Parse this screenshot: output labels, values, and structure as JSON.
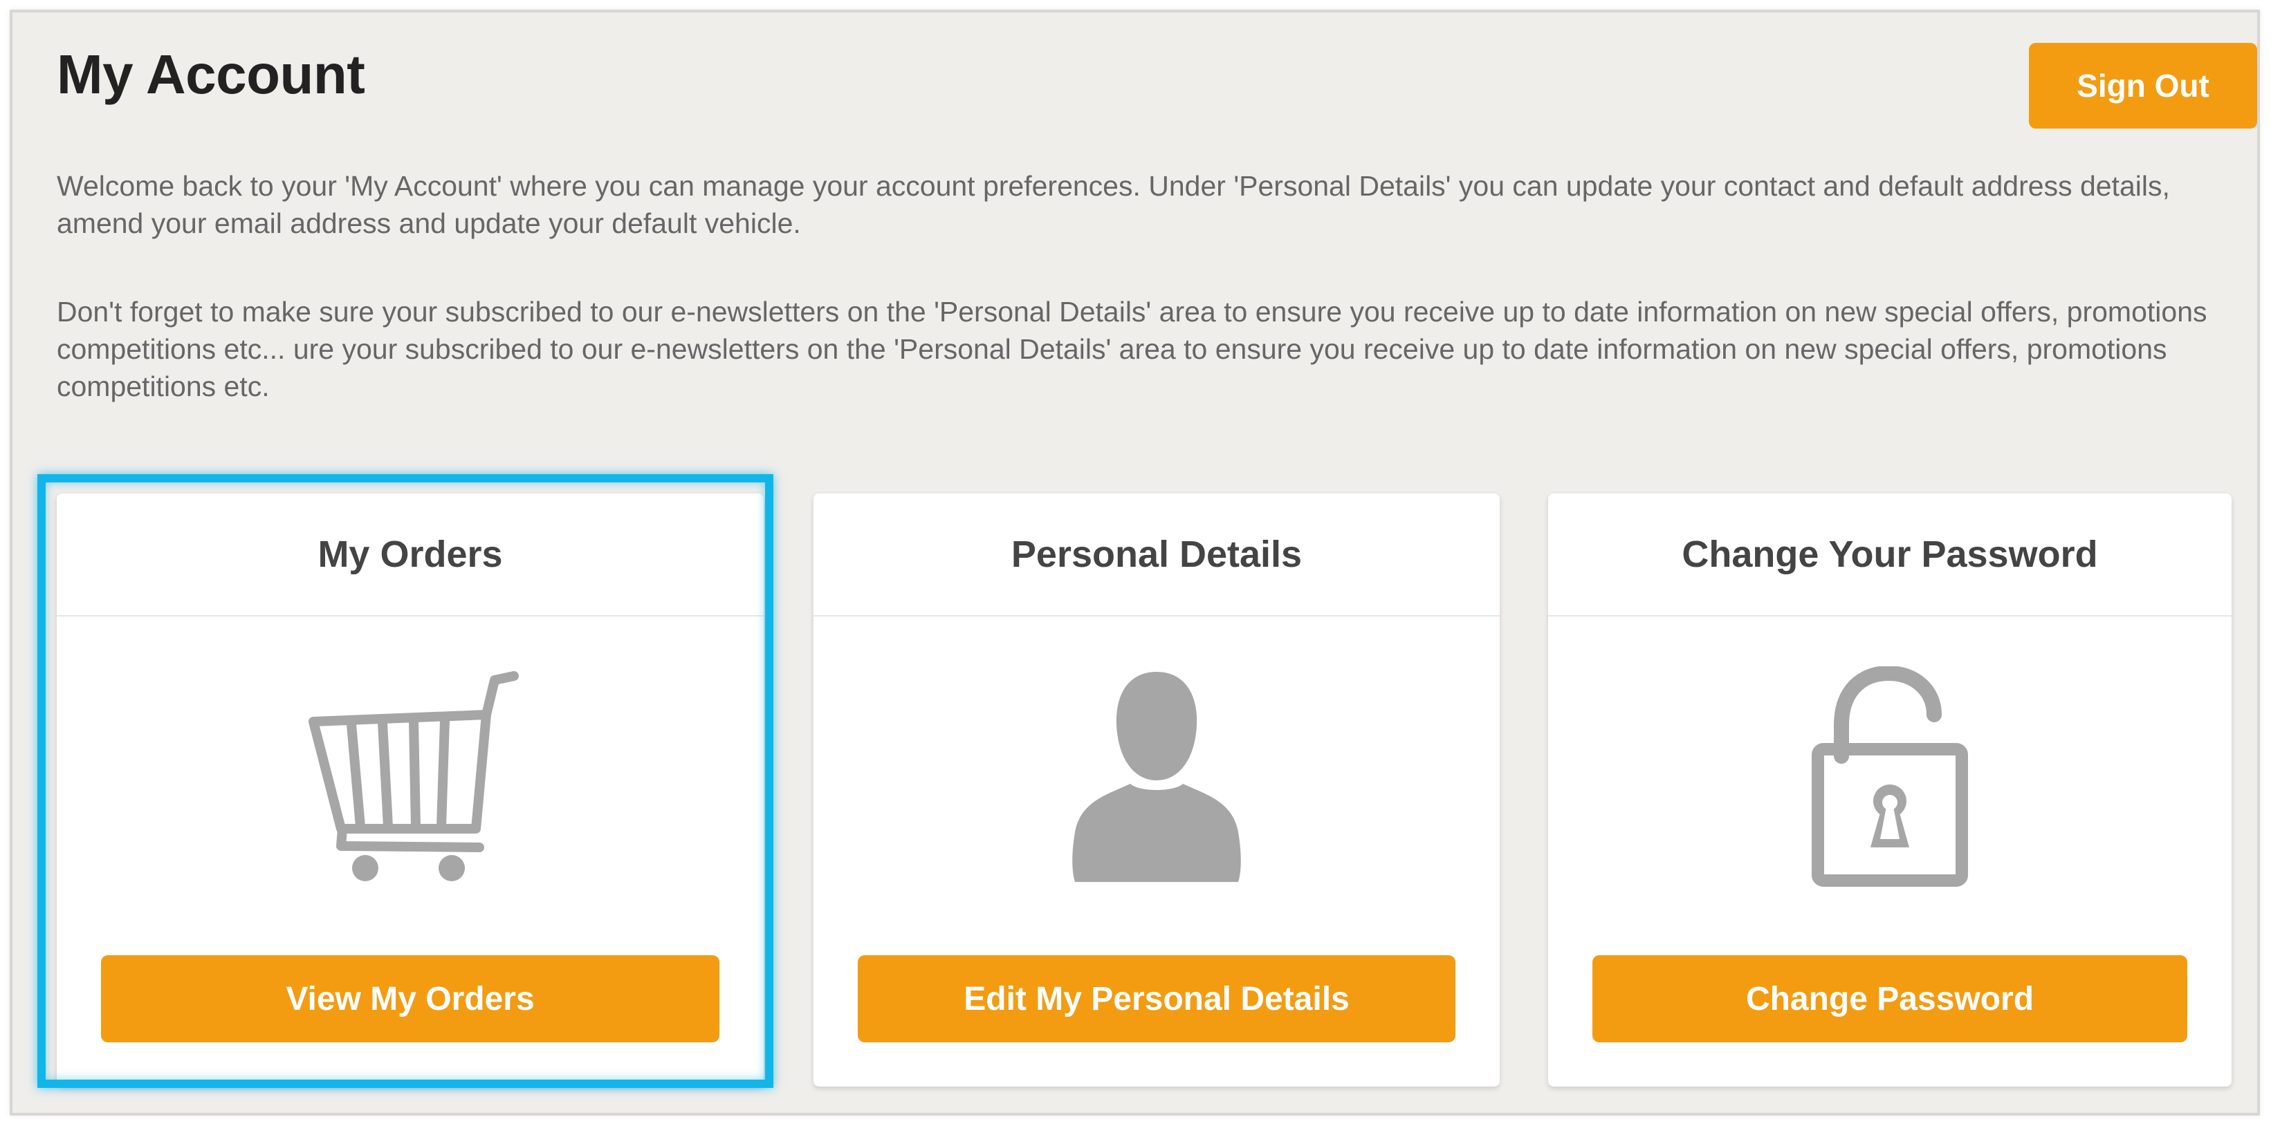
{
  "header": {
    "title": "My Account",
    "sign_out_label": "Sign Out"
  },
  "intro": {
    "paragraph_1": "Welcome back to your 'My Account' where you can manage your account preferences. Under 'Personal Details' you can update your contact and default address details, amend your email address and update your default vehicle.",
    "paragraph_2": "Don't forget to make sure your subscribed to our e-newsletters on the 'Personal Details' area to ensure you receive up to date information on new special offers, promotions competitions etc... ure your subscribed to our e-newsletters on the 'Personal Details' area to ensure you receive up to date information on new special offers, promotions competitions etc."
  },
  "cards": [
    {
      "title": "My Orders",
      "icon": "shopping-cart-icon",
      "button_label": "View My Orders",
      "highlighted": true
    },
    {
      "title": "Personal Details",
      "icon": "user-icon",
      "button_label": "Edit My Personal Details",
      "highlighted": false
    },
    {
      "title": "Change Your Password",
      "icon": "unlocked-padlock-icon",
      "button_label": "Change Password",
      "highlighted": false
    }
  ],
  "colors": {
    "accent": "#f39c12",
    "highlight": "#12b5ea",
    "background": "#f0eeeb",
    "icon": "#a6a6a6"
  }
}
